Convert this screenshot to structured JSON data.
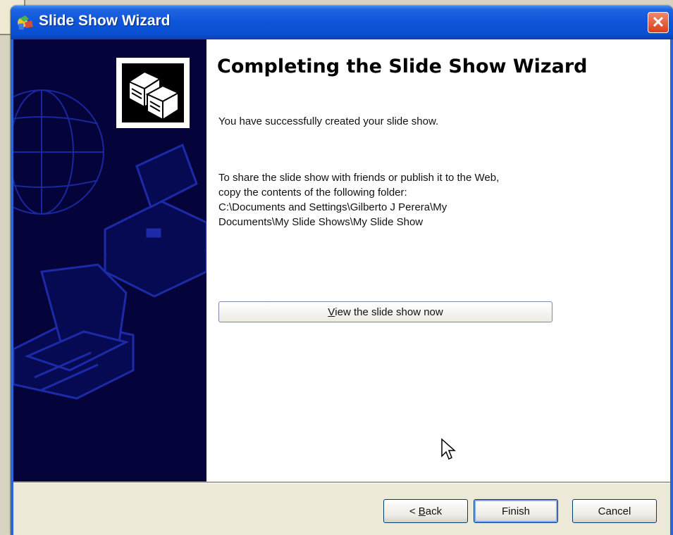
{
  "window": {
    "title": "Slide Show Wizard",
    "close_glyph": "✕"
  },
  "main": {
    "heading": "Completing the Slide Show Wizard",
    "success_text": "You have successfully created your slide show.",
    "share_lines": [
      "To share the slide show with friends or publish it to the Web,",
      "copy the contents of the following folder:",
      "C:\\Documents and Settings\\Gilberto J Perera\\My",
      "Documents\\My Slide Shows\\My Slide Show"
    ],
    "view_button": {
      "mnemonic": "V",
      "rest": "iew the slide show now"
    }
  },
  "buttons": {
    "back": {
      "prefix": "< ",
      "mnemonic": "B",
      "rest": "ack"
    },
    "finish": "Finish",
    "cancel": "Cancel"
  },
  "icons": {
    "title": "wizard-app-icon",
    "header": "computers-icon",
    "cursor": "mouse-pointer-icon"
  },
  "colors": {
    "titlebar": "#0d55d9",
    "side_panel": "#04043b",
    "close": "#d9401c",
    "dialog_bottom": "#ece9d8"
  }
}
